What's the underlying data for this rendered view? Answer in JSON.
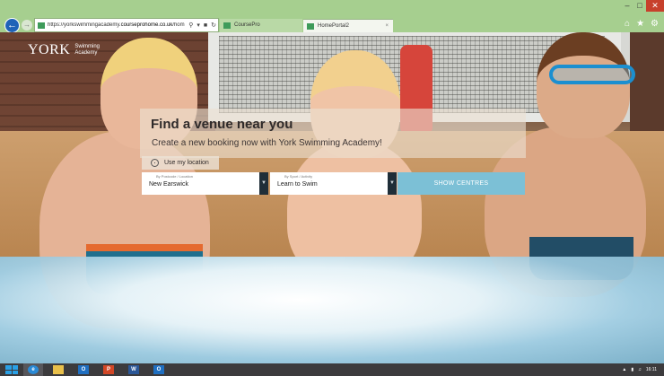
{
  "browser": {
    "url_prefix": "https://yorkswimmingacademy.",
    "url_domain": "courseprohome.co.uk",
    "url_suffix": "/hom",
    "tabs": [
      {
        "label": "CoursePro",
        "active": false
      },
      {
        "label": "HomePortal2",
        "active": true
      }
    ],
    "window_controls": {
      "minimize": "–",
      "maximize": "□",
      "close": "✕"
    }
  },
  "logo": {
    "mark": "YORK",
    "line1": "Swimming",
    "line2": "Academy"
  },
  "search": {
    "heading": "Find a venue near you",
    "subheading": "Create a new booking now with York Swimming Academy!",
    "location_button": "Use my location",
    "postcode_label": "By Postcode / Location",
    "postcode_value": "New Earswick",
    "sport_label": "By Sport / Activity",
    "sport_value": "Learn to Swim",
    "submit_label": "SHOW CENTRES"
  },
  "taskbar": {
    "apps": [
      {
        "name": "ie",
        "glyph": "e"
      },
      {
        "name": "explorer",
        "glyph": ""
      },
      {
        "name": "outlook",
        "glyph": "O"
      },
      {
        "name": "ppt",
        "glyph": "P"
      },
      {
        "name": "word",
        "glyph": "W"
      },
      {
        "name": "outlook2",
        "glyph": "O"
      }
    ],
    "clock_time": "16:11"
  },
  "colors": {
    "chrome": "#a6cf8f",
    "accent_button": "#7cc0d6",
    "dropdown": "#1f2e38",
    "taskbar": "#3c3b3d"
  }
}
